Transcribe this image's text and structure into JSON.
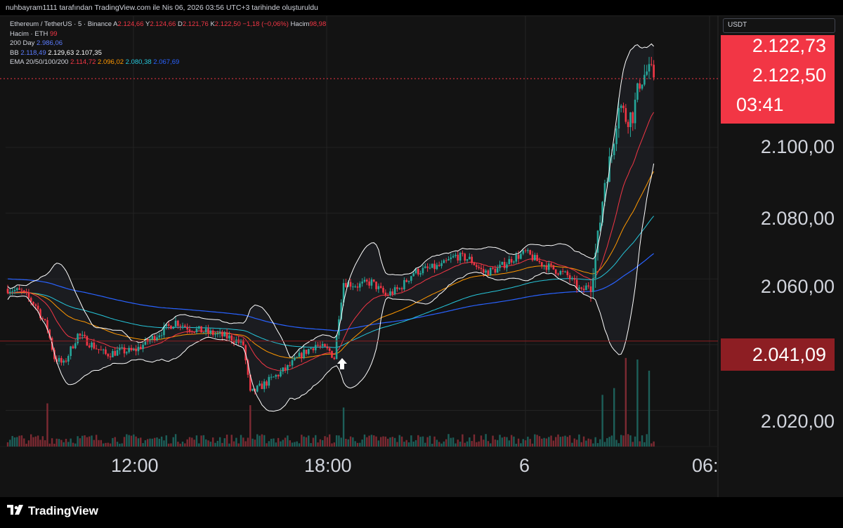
{
  "header": {
    "snapshot_text": "nuhbayram1111 tarafından TradingView.com ile Nis 06, 2026 03:56 UTC+3 tarihinde oluşturuldu"
  },
  "legend": {
    "symbol": "Ethereum / TetherUS · 5 · Binance",
    "ohlc": [
      {
        "k": "A",
        "v": "2.124,66"
      },
      {
        "k": "Y",
        "v": "2.124,66"
      },
      {
        "k": "D",
        "v": "2.121,76"
      },
      {
        "k": "K",
        "v": "2.122,50"
      }
    ],
    "change": "−1,18 (−0,06%)",
    "volume_key": "Hacim",
    "volume_val": "98,98",
    "vol_row_label": "Hacim · ETH",
    "vol_row_val": "99",
    "sma_label": "200 Day",
    "sma_val": "2.986,06",
    "bb_label": "BB",
    "bb_vals": [
      "2.118,49",
      "2.129,63",
      "2.107,35"
    ],
    "ema_label": "EMA 20/50/100/200",
    "ema_vals": [
      "2.114,72",
      "2.096,02",
      "2.080,38",
      "2.067,69"
    ]
  },
  "price_scale": {
    "currency": "USDT",
    "current_price": "2.122,73",
    "last_price": "2.122,50",
    "countdown": "03:41",
    "level_label": "2.041,09",
    "ticks": [
      "2.100,00",
      "2.080,00",
      "2.060,00",
      "2.020,00"
    ]
  },
  "time_scale": {
    "ticks": [
      "12:00",
      "18:00",
      "6",
      "06:"
    ]
  },
  "brand": {
    "name": "TradingView"
  },
  "colors": {
    "up": "#26a69a",
    "down": "#f23645",
    "bb": "#ffffff",
    "ema20": "#f23645",
    "ema50": "#ff9800",
    "ema100": "#26c6da",
    "ema200": "#2962ff",
    "sma200": "#3f51b5"
  },
  "chart_data": {
    "type": "candlestick",
    "symbol": "ETHUSDT",
    "interval": "5",
    "y_range": [
      2012,
      2138
    ],
    "reference_level": 2041.09,
    "price_path": [
      [
        0,
        2057
      ],
      [
        6,
        2056
      ],
      [
        12,
        2052
      ],
      [
        17,
        2045
      ],
      [
        20,
        2036
      ],
      [
        24,
        2034
      ],
      [
        30,
        2043
      ],
      [
        36,
        2040
      ],
      [
        42,
        2037
      ],
      [
        48,
        2038
      ],
      [
        54,
        2038
      ],
      [
        60,
        2041
      ],
      [
        66,
        2044
      ],
      [
        72,
        2047
      ],
      [
        78,
        2045
      ],
      [
        84,
        2044
      ],
      [
        90,
        2043
      ],
      [
        96,
        2042
      ],
      [
        101,
        2040
      ],
      [
        104,
        2025
      ],
      [
        108,
        2027
      ],
      [
        114,
        2030
      ],
      [
        120,
        2033
      ],
      [
        126,
        2037
      ],
      [
        132,
        2040
      ],
      [
        138,
        2038
      ],
      [
        140,
        2036
      ],
      [
        142,
        2049
      ],
      [
        144,
        2059
      ],
      [
        150,
        2058
      ],
      [
        156,
        2059
      ],
      [
        162,
        2055
      ],
      [
        168,
        2057
      ],
      [
        174,
        2062
      ],
      [
        180,
        2063
      ],
      [
        186,
        2064
      ],
      [
        192,
        2067
      ],
      [
        198,
        2066
      ],
      [
        204,
        2062
      ],
      [
        210,
        2063
      ],
      [
        216,
        2066
      ],
      [
        222,
        2068
      ],
      [
        228,
        2065
      ],
      [
        234,
        2063
      ],
      [
        240,
        2061
      ],
      [
        246,
        2056
      ],
      [
        250,
        2059
      ],
      [
        253,
        2072
      ],
      [
        256,
        2090
      ],
      [
        259,
        2098
      ],
      [
        262,
        2114
      ],
      [
        265,
        2109
      ],
      [
        268,
        2110
      ],
      [
        271,
        2120
      ],
      [
        274,
        2123
      ],
      [
        277,
        2122
      ]
    ]
  }
}
